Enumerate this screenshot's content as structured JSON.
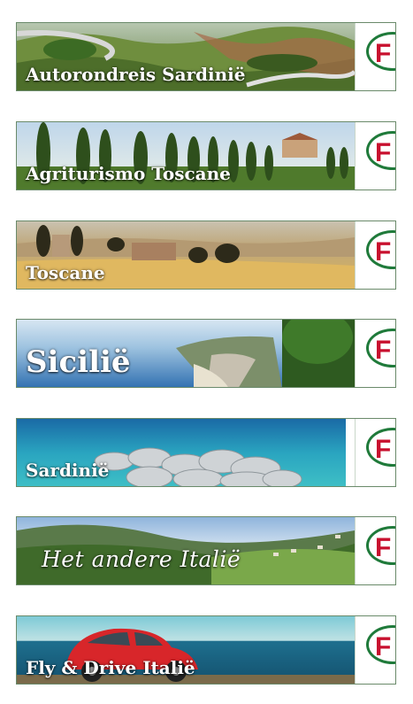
{
  "banners": [
    {
      "title": "Autorondreis Sardinië",
      "scene": "mountain-road"
    },
    {
      "title": "Agriturismo Toscane",
      "scene": "cypress-alley"
    },
    {
      "title": "Toscane",
      "scene": "tuscan-fields"
    },
    {
      "title": "Sicilië",
      "scene": "sicilian-coast"
    },
    {
      "title": "Sardinië",
      "scene": "rocky-pier"
    },
    {
      "title": "Het andere Italië",
      "scene": "green-valley"
    },
    {
      "title": "Fly & Drive Italië",
      "scene": "red-beetle-seaside"
    }
  ],
  "logo": {
    "letter": "F",
    "ring_color": "#1f7a3a",
    "letter_color": "#c8102e"
  }
}
